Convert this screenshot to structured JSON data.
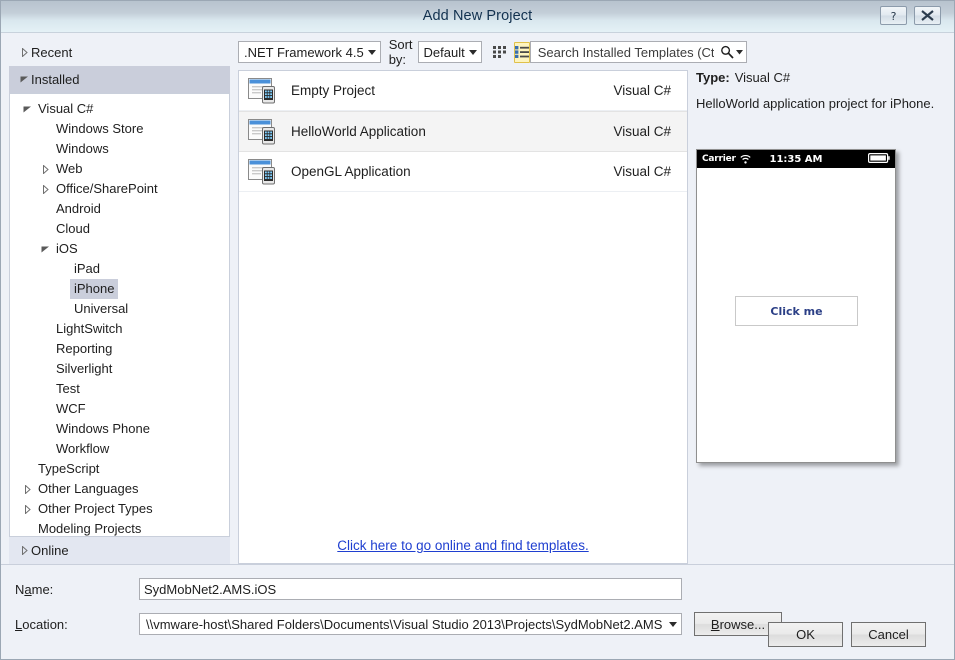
{
  "window": {
    "title": "Add New Project",
    "help_button": "?",
    "close_button": "✕"
  },
  "sidebar": {
    "sections": [
      {
        "label": "Recent",
        "expanded": false,
        "selected": false
      },
      {
        "label": "Installed",
        "expanded": true,
        "selected": true
      }
    ],
    "online": {
      "label": "Online",
      "expanded": false
    },
    "tree": [
      {
        "label": "Visual C#",
        "indent": 0,
        "arrow": "down",
        "selected": false
      },
      {
        "label": "Windows Store",
        "indent": 1,
        "arrow": "none",
        "selected": false
      },
      {
        "label": "Windows",
        "indent": 1,
        "arrow": "none",
        "selected": false
      },
      {
        "label": "Web",
        "indent": 1,
        "arrow": "right",
        "selected": false
      },
      {
        "label": "Office/SharePoint",
        "indent": 1,
        "arrow": "right",
        "selected": false
      },
      {
        "label": "Android",
        "indent": 1,
        "arrow": "none",
        "selected": false
      },
      {
        "label": "Cloud",
        "indent": 1,
        "arrow": "none",
        "selected": false
      },
      {
        "label": "iOS",
        "indent": 1,
        "arrow": "down",
        "selected": false
      },
      {
        "label": "iPad",
        "indent": 2,
        "arrow": "none",
        "selected": false
      },
      {
        "label": "iPhone",
        "indent": 2,
        "arrow": "none",
        "selected": true
      },
      {
        "label": "Universal",
        "indent": 2,
        "arrow": "none",
        "selected": false
      },
      {
        "label": "LightSwitch",
        "indent": 1,
        "arrow": "none",
        "selected": false
      },
      {
        "label": "Reporting",
        "indent": 1,
        "arrow": "none",
        "selected": false
      },
      {
        "label": "Silverlight",
        "indent": 1,
        "arrow": "none",
        "selected": false
      },
      {
        "label": "Test",
        "indent": 1,
        "arrow": "none",
        "selected": false
      },
      {
        "label": "WCF",
        "indent": 1,
        "arrow": "none",
        "selected": false
      },
      {
        "label": "Windows Phone",
        "indent": 1,
        "arrow": "none",
        "selected": false
      },
      {
        "label": "Workflow",
        "indent": 1,
        "arrow": "none",
        "selected": false
      },
      {
        "label": "TypeScript",
        "indent": 0,
        "arrow": "none",
        "selected": false
      },
      {
        "label": "Other Languages",
        "indent": 0,
        "arrow": "right",
        "selected": false
      },
      {
        "label": "Other Project Types",
        "indent": 0,
        "arrow": "right",
        "selected": false
      },
      {
        "label": "Modeling Projects",
        "indent": 0,
        "arrow": "none",
        "selected": false
      }
    ]
  },
  "toolbar": {
    "framework_value": ".NET Framework 4.5",
    "sort_by_label": "Sort by:",
    "sort_value": "Default",
    "tile_view_name": "tile-view",
    "list_view_name": "list-view",
    "search_placeholder": "Search Installed Templates (Ctrl+E)",
    "search_value": ""
  },
  "templates": {
    "items": [
      {
        "name": "Empty Project",
        "language": "Visual C#",
        "selected": false
      },
      {
        "name": "HelloWorld Application",
        "language": "Visual C#",
        "selected": true
      },
      {
        "name": "OpenGL Application",
        "language": "Visual C#",
        "selected": false
      }
    ],
    "online_link": "Click here to go online and find templates."
  },
  "info": {
    "type_key": "Type:",
    "type_value": "Visual C#",
    "description": "HelloWorld application project for iPhone.",
    "preview": {
      "carrier": "Carrier",
      "clock": "11:35 AM",
      "button_label": "Click me"
    }
  },
  "form": {
    "name_label_pre": "N",
    "name_label_accel": "a",
    "name_label_post": "me:",
    "name_value": "SydMobNet2.AMS.iOS",
    "location_label_accel": "L",
    "location_label_post": "ocation:",
    "location_value": "\\\\vmware-host\\Shared Folders\\Documents\\Visual Studio 2013\\Projects\\SydMobNet2.AMS",
    "browse_pre": "B",
    "browse_post": "rowse..."
  },
  "actions": {
    "ok_label": "OK",
    "cancel_label": "Cancel"
  },
  "colors": {
    "accent_link": "#1f3fd0",
    "selection": "#cacedb",
    "view_toggle_active": "#fdf4bf",
    "view_toggle_border": "#e0c14a",
    "titlebar_top": "#b7c3ce",
    "titlebar_bottom": "#e4f1f6"
  }
}
